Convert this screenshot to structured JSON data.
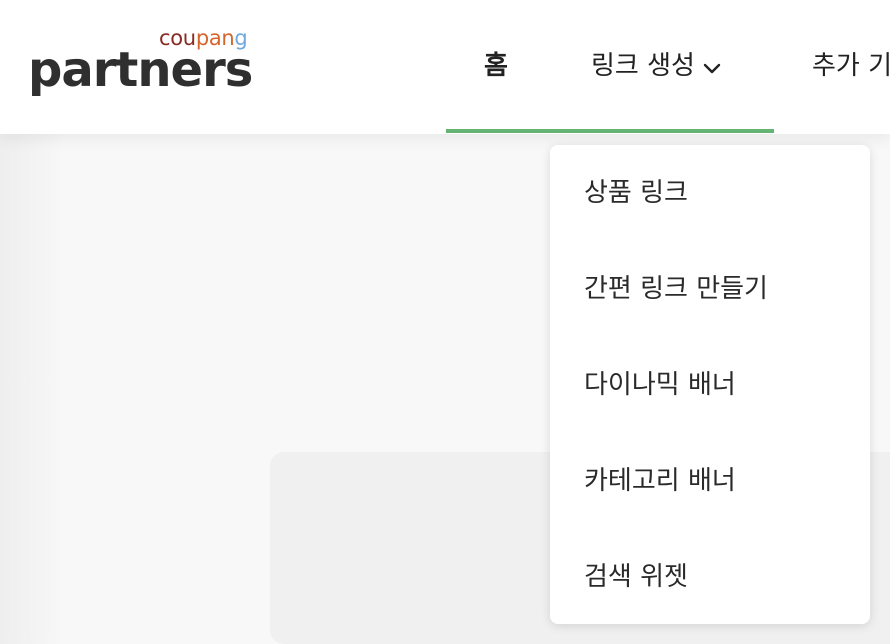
{
  "logo": {
    "coupang_parts": [
      {
        "text": "cou",
        "color": "#8a2a22"
      },
      {
        "text": "pan",
        "color": "#d8642b"
      },
      {
        "text": "g",
        "color": "#6fa9dd"
      }
    ],
    "partners": "partners"
  },
  "nav": {
    "home": "홈",
    "link_create": "링크 생성",
    "extra": "추가 기"
  },
  "dropdown": {
    "items": [
      "상품 링크",
      "간편 링크 만들기",
      "다이나믹 배너",
      "카테고리 배너",
      "검색 위젯"
    ]
  },
  "colors": {
    "active_underline": "#64b574"
  }
}
